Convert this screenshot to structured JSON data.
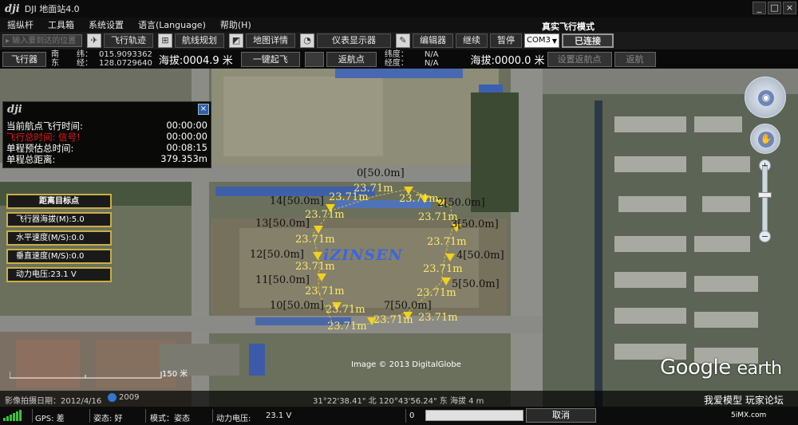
{
  "window": {
    "logo": "dji",
    "title": "DJI 地面站4.0",
    "min_label": "_",
    "max_label": "□",
    "close_label": "×"
  },
  "menu": {
    "items": [
      "摇纵杆",
      "工具箱",
      "系统设置",
      "语言(Language)",
      "帮助(H)"
    ],
    "mode": "真实飞行模式"
  },
  "toolbar": {
    "address_placeholder": "▸ 输入要到达的位置",
    "flight_track": "飞行轨迹",
    "route_planning": "航线规划",
    "map_detail": "地图详情",
    "instrument_display": "仪表显示器",
    "editor": "编辑器",
    "continue": "继续",
    "pause": "暂停",
    "port": "COM3",
    "connected": "已连接"
  },
  "status": {
    "aircraft_btn": "飞行器",
    "ns_labels": [
      "南",
      "东"
    ],
    "lat_label": "纬：",
    "lon_label": "经：",
    "lat": "015.9093362",
    "lon": "128.0729640",
    "altitude_text": "海拔:0004.9 米",
    "takeoff_btn": "一键起飞",
    "return_btn": "返航点",
    "target_lat_label": "纬度：",
    "target_lon_label": "经度：",
    "target_lat": "N/A",
    "target_lon": "N/A",
    "target_altitude_text": "海拔:0000.0 米",
    "set_return_btn": "设置返航点",
    "return_btn2": "返航"
  },
  "info": {
    "logo": "dji",
    "close": "×",
    "rows": [
      {
        "label": "当前航点飞行时间:",
        "value": "00:00:00",
        "warn": false
      },
      {
        "label": "飞行总时间: 信号!",
        "value": "00:00:00",
        "warn": true
      },
      {
        "label": "单程预估总时间:",
        "value": "00:08:15",
        "warn": false
      },
      {
        "label": "单程总距离:",
        "value": "379.353m",
        "warn": false
      }
    ]
  },
  "gauges": {
    "title": "距离目标点",
    "aircraft_alt": "飞行器海拔(M):5.0",
    "h_speed": "水平速度(M/S):0.0",
    "v_speed": "垂直速度(M/S):0.0",
    "voltage": "动力电压:23.1 V"
  },
  "waypoints": [
    {
      "id": "0",
      "label": "0[50.0m]",
      "alt": "23.71m"
    },
    {
      "id": "1",
      "label": "1",
      "alt": "23.71m"
    },
    {
      "id": "2",
      "label": "2[50.0m]",
      "alt": "23.71m"
    },
    {
      "id": "3",
      "label": "3[50.0m]",
      "alt": "23.71m"
    },
    {
      "id": "4",
      "label": "4[50.0m]",
      "alt": "23.71m"
    },
    {
      "id": "5",
      "label": "5[50.0m]",
      "alt": "23.71m"
    },
    {
      "id": "7",
      "label": "7[50.0m]",
      "alt": "23.71m"
    },
    {
      "id": "8",
      "label": "",
      "alt": "23.71m"
    },
    {
      "id": "9",
      "label": "",
      "alt": "23.71m"
    },
    {
      "id": "10",
      "label": "10[50.0m]",
      "alt": "23.71m"
    },
    {
      "id": "11",
      "label": "11[50.0m]",
      "alt": "23.71m"
    },
    {
      "id": "12",
      "label": "12[50.0m]",
      "alt": "23.71m"
    },
    {
      "id": "13",
      "label": "13[50.0m]",
      "alt": "23.71m"
    },
    {
      "id": "14",
      "label": "14[50.0m]",
      "alt": "23.71m"
    }
  ],
  "map": {
    "brand": "iZINSEN",
    "credit": "Image © 2013 DigitalGlobe",
    "google": "Google",
    "earth": "earth",
    "scale_label": "150 米",
    "imagery_date": "影像拍摄日期：2012/4/16",
    "year": "2009",
    "coords": "31°22'38.41\" 北  120°43'56.24\" 东  海拔  4 m",
    "watermark": "我爱模型 玩家论坛",
    "watermark_site": "5iMX.com",
    "zoom_plus": "+",
    "zoom_minus": "−"
  },
  "statusbar": {
    "gps": "GPS: 差",
    "attitude": "姿态: 好",
    "mode": "模式：姿态",
    "voltage_label": "动力电压:",
    "voltage_value": "23.1 V",
    "progress_value": "0",
    "progress_fraction": 0,
    "cancel": "取消"
  },
  "colors": {
    "gauge_border": "#c9b043",
    "waypoint_marker": "#f2d11e",
    "warning": "#e21a1a",
    "brand": "#3a66e0"
  }
}
